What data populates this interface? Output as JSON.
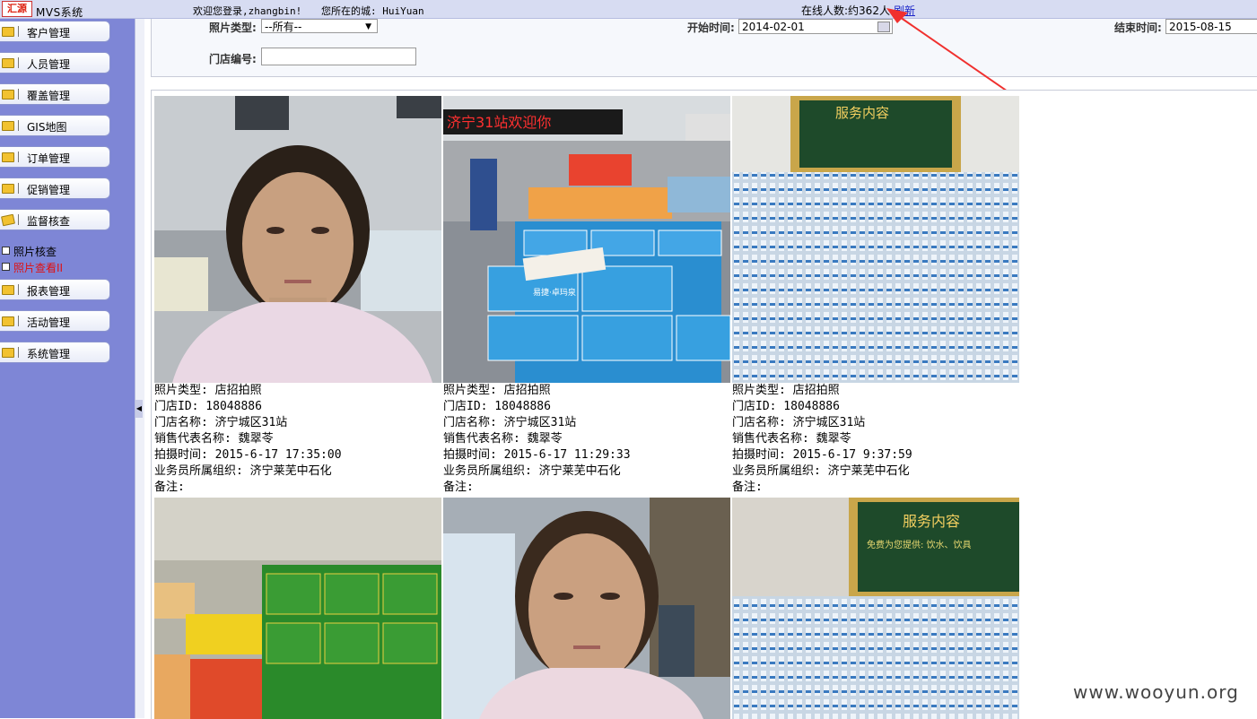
{
  "header": {
    "logo_text": "汇源",
    "system_name": "MVS系统",
    "welcome": "欢迎您登录,zhangbin!",
    "city": "您所在的城: HuiYuan",
    "online": "在线人数:约362人",
    "refresh": "刷新"
  },
  "sidebar": {
    "menu": [
      "客户管理",
      "人员管理",
      "覆盖管理",
      "GIS地图",
      "订单管理",
      "促销管理",
      "监督核查",
      "报表管理",
      "活动管理",
      "系统管理"
    ],
    "sub_items": [
      "照片核查",
      "照片查看II"
    ]
  },
  "filter": {
    "photo_type_label": "照片类型:",
    "photo_type_value": "--所有--",
    "start_label": "开始时间:",
    "start_value": "2014-02-01",
    "end_label": "结束时间:",
    "end_value": "2015-08-15",
    "store_label": "门店编号:",
    "store_value": ""
  },
  "photos": [
    {
      "type": "照片类型: 店招拍照",
      "store_id": "门店ID: 18048886",
      "store_name": "门店名称: 济宁城区31站",
      "rep": "销售代表名称: 魏翠苓",
      "time": "拍摄时间: 2015-6-17 17:35:00",
      "org": "业务员所属组织: 济宁莱芜中石化",
      "note": "备注:"
    },
    {
      "type": "照片类型: 店招拍照",
      "store_id": "门店ID: 18048886",
      "store_name": "门店名称: 济宁城区31站",
      "rep": "销售代表名称: 魏翠苓",
      "time": "拍摄时间: 2015-6-17 11:29:33",
      "org": "业务员所属组织: 济宁莱芜中石化",
      "note": "备注:"
    },
    {
      "type": "照片类型: 店招拍照",
      "store_id": "门店ID: 18048886",
      "store_name": "门店名称: 济宁城区31站",
      "rep": "销售代表名称: 魏翠苓",
      "time": "拍摄时间: 2015-6-17 9:37:59",
      "org": "业务员所属组织: 济宁莱芜中石化",
      "note": "备注:"
    }
  ],
  "photo_text": {
    "banner": "济宁31站欢迎你",
    "service": "服务内容",
    "service_sub": "免费为您提供: 饮水、饮具",
    "brand": "易捷·卓玛泉"
  },
  "watermark": "www.wooyun.org"
}
